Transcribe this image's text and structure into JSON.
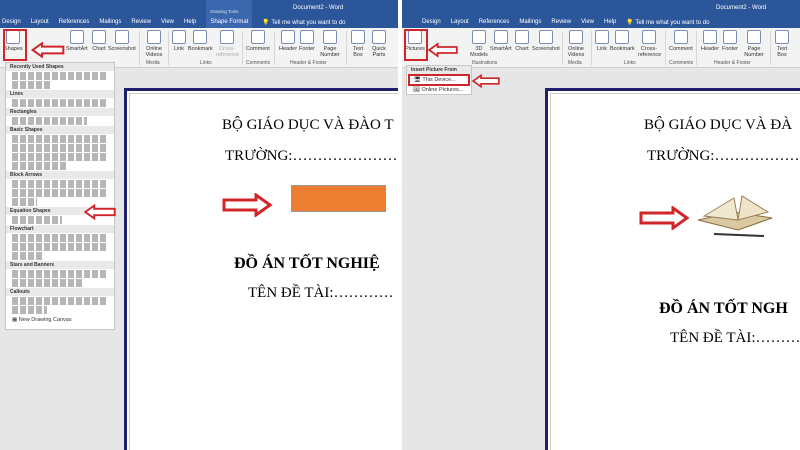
{
  "left": {
    "title": "Document2 - Word",
    "context_group": "Drawing Tools",
    "tabs": [
      "Design",
      "Layout",
      "References",
      "Mailings",
      "Review",
      "View",
      "Help",
      "Shape Format"
    ],
    "tell_me": "Tell me what you want to do",
    "ribbon": {
      "shapes": "Shapes",
      "smartart": "SmartArt",
      "chart": "Chart",
      "screenshot": "Screenshot",
      "online_videos": "Online Videos",
      "link": "Link",
      "bookmark": "Bookmark",
      "cross_reference": "Cross-reference",
      "comment": "Comment",
      "header": "Header",
      "footer": "Footer",
      "page_number": "Page Number",
      "text_box": "Text Box",
      "quick_parts": "Quick Parts"
    },
    "groups": {
      "media": "Media",
      "links": "Links",
      "comments": "Comments",
      "header_footer": "Header & Footer"
    },
    "shapes_menu": {
      "sections": [
        "Recently Used Shapes",
        "Lines",
        "Rectangles",
        "Basic Shapes",
        "Block Arrows",
        "Equation Shapes",
        "Flowchart",
        "Stars and Banners",
        "Callouts"
      ],
      "new_canvas": "New Drawing Canvas"
    },
    "doc": {
      "line1": "BỘ GIÁO DỤC VÀ ĐÀO T",
      "line2": "TRƯỜNG:…………………",
      "line3": "ĐỒ ÁN TỐT NGHIỆ",
      "line4": "TÊN ĐỀ TÀI:…………"
    },
    "shape_color": "#ed7d31"
  },
  "right": {
    "title": "Document2 - Word",
    "tabs": [
      "Design",
      "Layout",
      "References",
      "Mailings",
      "Review",
      "View",
      "Help"
    ],
    "tell_me": "Tell me what you want to do",
    "ribbon": {
      "pictures": "Pictures",
      "models_3d": "3D Models",
      "smartart": "SmartArt",
      "chart": "Chart",
      "screenshot": "Screenshot",
      "online_videos": "Online Videos",
      "link": "Link",
      "bookmark": "Bookmark",
      "cross_reference": "Cross-reference",
      "comment": "Comment",
      "header": "Header",
      "footer": "Footer",
      "page_number": "Page Number",
      "text_box": "Text Box"
    },
    "groups": {
      "illustrations": "Illustrations",
      "media": "Media",
      "links": "Links",
      "comments": "Comments",
      "header_footer": "Header & Footer"
    },
    "picture_menu": {
      "header": "Insert Picture From",
      "items": [
        "This Device...",
        "Online Pictures..."
      ]
    },
    "doc": {
      "line1": "BỘ GIÁO DỤC VÀ ĐÀ",
      "line2": "TRƯỜNG:…………………",
      "line3": "ĐỒ ÁN TỐT NGH",
      "line4": "TÊN ĐỀ TÀI:………"
    }
  },
  "accent": "#2b579a",
  "highlight": "#d0262a"
}
